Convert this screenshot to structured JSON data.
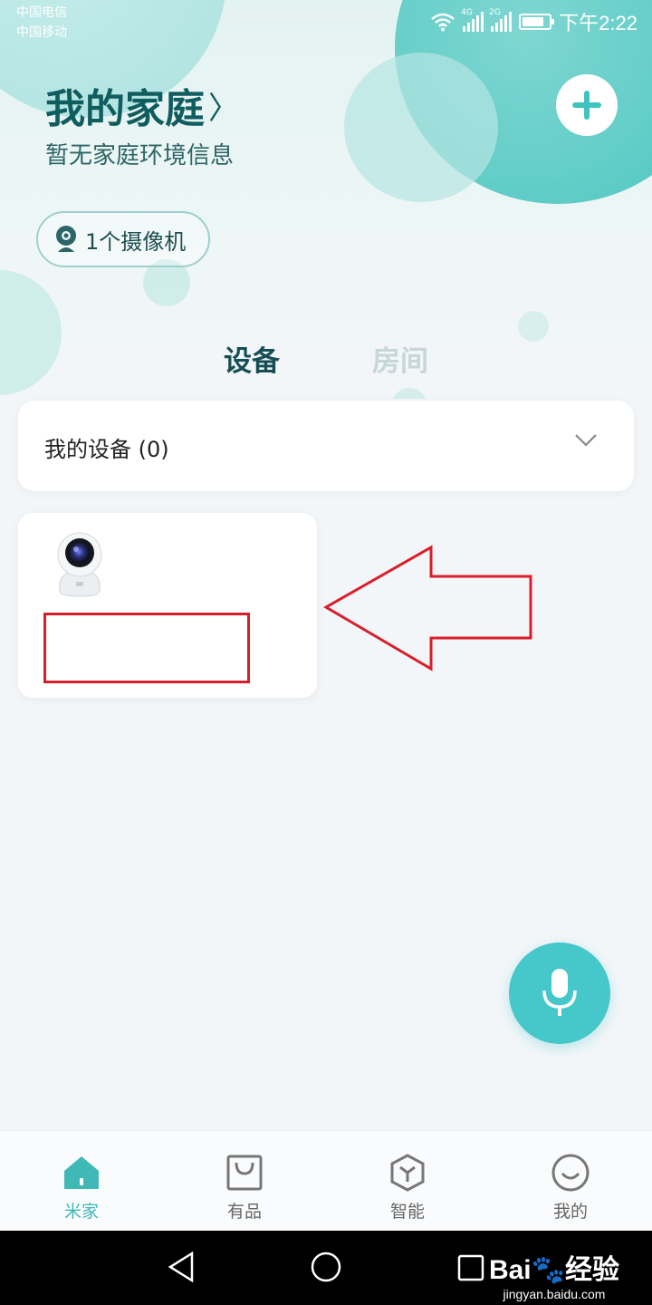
{
  "status_bar": {
    "carrier1": "中国电信",
    "carrier2": "中国移动",
    "net1": "4G",
    "net2": "2G",
    "time": "下午2:22"
  },
  "header": {
    "title": "我的家庭",
    "subtitle": "暂无家庭环境信息",
    "camera_chip": "1个摄像机"
  },
  "tabs": [
    {
      "label": "设备",
      "active": true
    },
    {
      "label": "房间",
      "active": false
    }
  ],
  "devices_section": {
    "label": "我的设备 (0)"
  },
  "bottom_nav": [
    {
      "label": "米家",
      "icon": "home-icon",
      "active": true
    },
    {
      "label": "有品",
      "icon": "bag-icon",
      "active": false
    },
    {
      "label": "智能",
      "icon": "hexagon-icon",
      "active": false
    },
    {
      "label": "我的",
      "icon": "smile-icon",
      "active": false
    }
  ],
  "watermark": {
    "brand": "Bai🐾经验",
    "url": "jingyan.baidu.com"
  },
  "colors": {
    "accent": "#46c7c9",
    "title": "#0f5d5e",
    "annotation": "#d91e2a"
  }
}
